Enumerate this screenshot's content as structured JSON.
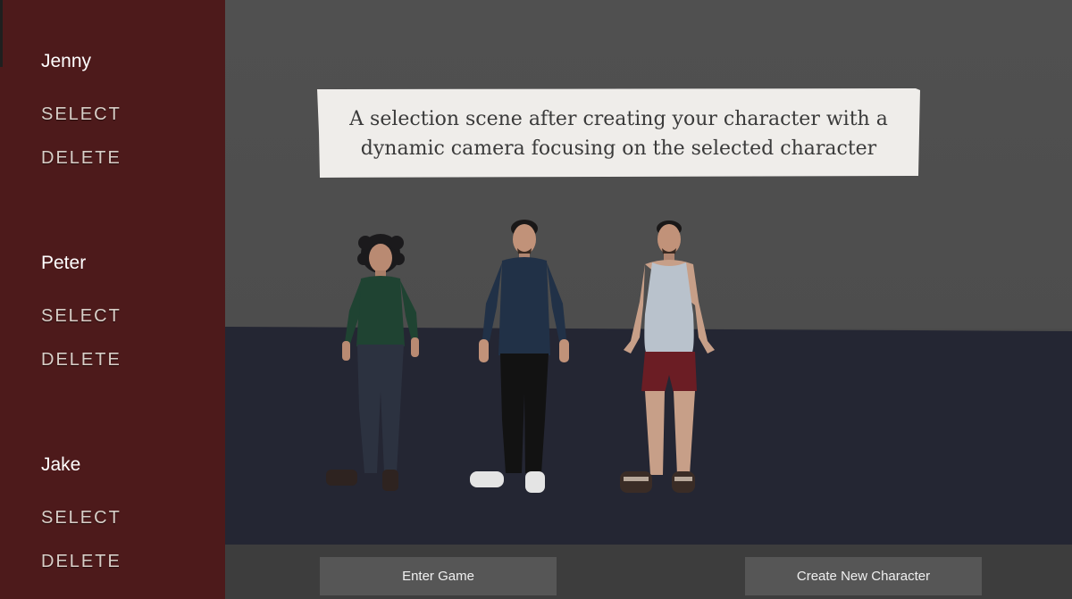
{
  "characters": [
    {
      "name": "Jenny",
      "select_label": "SELECT",
      "delete_label": "DELETE"
    },
    {
      "name": "Peter",
      "select_label": "SELECT",
      "delete_label": "DELETE"
    },
    {
      "name": "Jake",
      "select_label": "SELECT",
      "delete_label": "DELETE"
    }
  ],
  "caption": {
    "line1": "A selection scene after creating your character with a",
    "line2": "dynamic camera focusing on the selected character"
  },
  "buttons": {
    "enter_game": "Enter Game",
    "create_new_character": "Create New Character"
  },
  "colors": {
    "sidebar": "#4d1a1b",
    "wall": "#4e4e4e",
    "floor": "#242633",
    "button": "#565656",
    "bottom_bar": "#3d3d3d"
  }
}
